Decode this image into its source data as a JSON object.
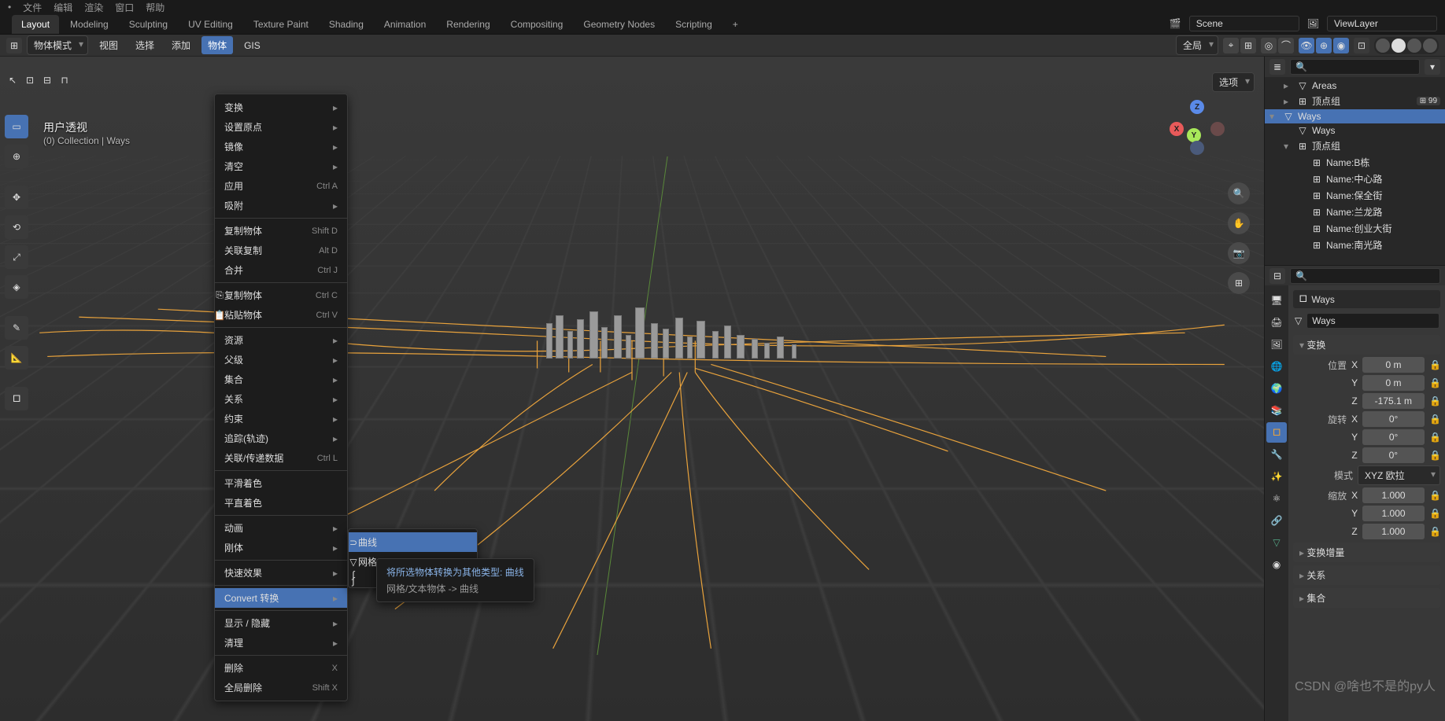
{
  "topMenu": [
    "文件",
    "编辑",
    "渲染",
    "窗口",
    "帮助"
  ],
  "tabs": [
    "Layout",
    "Modeling",
    "Sculpting",
    "UV Editing",
    "Texture Paint",
    "Shading",
    "Animation",
    "Rendering",
    "Compositing",
    "Geometry Nodes",
    "Scripting"
  ],
  "activeTab": "Layout",
  "scene": {
    "label": "Scene",
    "layer": "ViewLayer"
  },
  "modeDropdown": "物体模式",
  "headerMenus": [
    "视图",
    "选择",
    "添加",
    "物体",
    "GIS"
  ],
  "orientation": "全局",
  "optionsLabel": "选项",
  "viewInfo": {
    "line1": "用户透视",
    "line2": "(0) Collection | Ways"
  },
  "gizmo": {
    "x": "X",
    "y": "Y",
    "z": "Z"
  },
  "objectMenu": {
    "items": [
      {
        "label": "变换",
        "sub": true
      },
      {
        "label": "设置原点",
        "sub": true
      },
      {
        "label": "镜像",
        "sub": true
      },
      {
        "label": "清空",
        "sub": true
      },
      {
        "label": "应用",
        "shortcut": "Ctrl A",
        "sub": true
      },
      {
        "label": "吸附",
        "sub": true
      },
      {
        "sep": true
      },
      {
        "label": "复制物体",
        "shortcut": "Shift D"
      },
      {
        "label": "关联复制",
        "shortcut": "Alt D"
      },
      {
        "label": "合并",
        "shortcut": "Ctrl J"
      },
      {
        "sep": true
      },
      {
        "label": "复制物体",
        "shortcut": "Ctrl C",
        "icon": "⎘"
      },
      {
        "label": "粘贴物体",
        "shortcut": "Ctrl V",
        "icon": "📋"
      },
      {
        "sep": true
      },
      {
        "label": "资源",
        "sub": true
      },
      {
        "label": "父级",
        "sub": true
      },
      {
        "label": "集合",
        "sub": true
      },
      {
        "label": "关系",
        "sub": true
      },
      {
        "label": "约束",
        "sub": true
      },
      {
        "label": "追踪(轨迹)",
        "sub": true
      },
      {
        "label": "关联/传递数据",
        "shortcut": "Ctrl L",
        "sub": true
      },
      {
        "sep": true
      },
      {
        "label": "平滑着色"
      },
      {
        "label": "平直着色"
      },
      {
        "sep": true
      },
      {
        "label": "动画",
        "sub": true
      },
      {
        "label": "刚体",
        "sub": true
      },
      {
        "sep": true
      },
      {
        "label": "快速效果",
        "sub": true
      },
      {
        "sep": true
      },
      {
        "label": "Convert 转换",
        "sub": true,
        "hl": true
      },
      {
        "sep": true
      },
      {
        "label": "显示 / 隐藏",
        "sub": true
      },
      {
        "label": "清理",
        "sub": true
      },
      {
        "sep": true
      },
      {
        "label": "删除",
        "shortcut": "X"
      },
      {
        "label": "全局删除",
        "shortcut": "Shift X"
      }
    ]
  },
  "convertSub": [
    {
      "label": "曲线",
      "hl": true,
      "icon": "⊃"
    },
    {
      "label": "网格",
      "icon": "▽"
    },
    {
      "label": "",
      "icon": "∫"
    },
    {
      "label": "",
      "icon": "∫"
    }
  ],
  "tooltip": {
    "line1": "将所选物体转换为其他类型:",
    "type": "曲线",
    "line2": "网格/文本物体 -> 曲线"
  },
  "outliner": {
    "items": [
      {
        "indent": 1,
        "exp": "▸",
        "icon": "▽",
        "label": "Areas"
      },
      {
        "indent": 1,
        "exp": "▸",
        "icon": "⊞",
        "label": "顶点组",
        "badge": "⊞ 99"
      },
      {
        "indent": 0,
        "exp": "▾",
        "icon": "▽",
        "label": "Ways",
        "sel": true
      },
      {
        "indent": 1,
        "exp": "",
        "icon": "▽",
        "label": "Ways"
      },
      {
        "indent": 1,
        "exp": "▾",
        "icon": "⊞",
        "label": "顶点组"
      },
      {
        "indent": 2,
        "exp": "",
        "icon": "⊞",
        "label": "Name:B栋"
      },
      {
        "indent": 2,
        "exp": "",
        "icon": "⊞",
        "label": "Name:中心路"
      },
      {
        "indent": 2,
        "exp": "",
        "icon": "⊞",
        "label": "Name:保全街"
      },
      {
        "indent": 2,
        "exp": "",
        "icon": "⊞",
        "label": "Name:兰龙路"
      },
      {
        "indent": 2,
        "exp": "",
        "icon": "⊞",
        "label": "Name:创业大街"
      },
      {
        "indent": 2,
        "exp": "",
        "icon": "⊞",
        "label": "Name:南光路"
      }
    ]
  },
  "props": {
    "name": "Ways",
    "crumb": "Ways",
    "transform": "变换",
    "location": "位置",
    "rotation": "旋转",
    "scale": "缩放",
    "mode": "模式",
    "modeVal": "XYZ 欧拉",
    "loc": {
      "x": "0 m",
      "y": "0 m",
      "z": "-175.1 m"
    },
    "rot": {
      "x": "0°",
      "y": "0°",
      "z": "0°"
    },
    "scl": {
      "x": "1.000",
      "y": "1.000",
      "z": "1.000"
    },
    "delta": "变换增量",
    "relations": "关系",
    "collections": "集合"
  },
  "watermark": "CSDN @啥也不是的py人"
}
